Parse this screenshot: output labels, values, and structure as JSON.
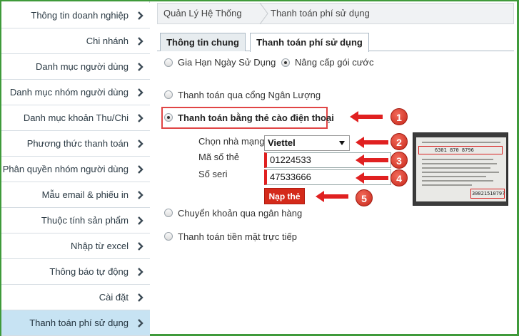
{
  "sidebar": {
    "items": [
      {
        "label": "Thông tin doanh nghiệp"
      },
      {
        "label": "Chi nhánh"
      },
      {
        "label": "Danh mục người dùng"
      },
      {
        "label": "Danh mục nhóm người dùng"
      },
      {
        "label": "Danh mục khoản Thu/Chi"
      },
      {
        "label": "Phương thức thanh toán"
      },
      {
        "label": "Phân quyền nhóm người dùng"
      },
      {
        "label": "Mẫu email & phiếu in"
      },
      {
        "label": "Thuộc tính sản phẩm"
      },
      {
        "label": "Nhập từ excel"
      },
      {
        "label": "Thông báo tự động"
      },
      {
        "label": "Cài đặt"
      },
      {
        "label": "Thanh toán phí sử dụng"
      }
    ]
  },
  "breadcrumb": {
    "home": "Quản Lý Hệ Thống",
    "current": "Thanh toán phí sử dụng"
  },
  "tabs": [
    {
      "label": "Thông tin chung"
    },
    {
      "label": "Thanh toán phí sử dụng"
    }
  ],
  "options": {
    "extend": "Gia Hạn Ngày Sử Dụng",
    "upgrade": "Nâng cấp gói cước",
    "nganluong": "Thanh toán qua cổng Ngân Lượng",
    "phonecard": "Thanh toán bằng thẻ cào điện thoại",
    "bank": "Chuyển khoản qua ngân hàng",
    "cash": "Thanh toán tiền mặt trực tiếp"
  },
  "form": {
    "network_label": "Chọn nhà mạng",
    "network_value": "Viettel",
    "card_label": "Mã số thẻ",
    "card_value": "01224533",
    "serial_label": "Số seri",
    "serial_value": "47533666",
    "submit": "Nạp thẻ"
  },
  "annotations": [
    "1",
    "2",
    "3",
    "4",
    "5"
  ],
  "card_image": {
    "code": "6301 870 8796",
    "serial": "3002151079?"
  },
  "colors": {
    "accent_red": "#d42a1a",
    "active_sidebar": "#c7e3f3",
    "frame_green": "#3f9a3a"
  }
}
